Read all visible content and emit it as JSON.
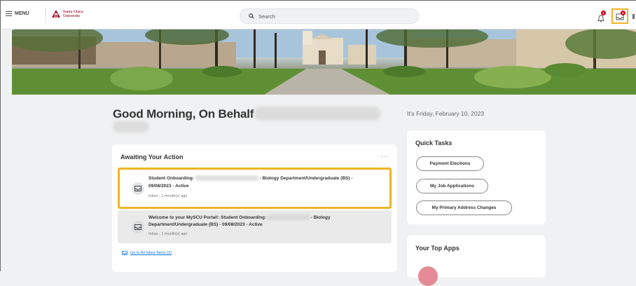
{
  "header": {
    "menu_label": "MENU",
    "logo_line1": "Santa Clara",
    "logo_line2": "University",
    "search_placeholder": "Search",
    "notification_count": "1",
    "inbox_count": "2"
  },
  "greeting": {
    "text": "Good Morning, On Behalf of:",
    "date": "It's Friday, February 10, 2023"
  },
  "awaiting": {
    "title": "Awaiting Your Action",
    "more": "···",
    "items": [
      {
        "line1_prefix": "Student Onboarding: ",
        "line1_suffix": " - Biology Department/Undergraduate (BS) -",
        "line2": "09/08/2023 - Active",
        "meta": "Inbox - 1 month(s) ago"
      },
      {
        "line1_prefix": "Welcome to your MySCU Portal!: Student Onboarding: ",
        "line1_suffix": " - Biology",
        "line2": "Department/Undergraduate (BS) - 09/08/2023 - Active",
        "meta": "Inbox - 1 month(s) ago"
      }
    ],
    "go_to_all": "Go to All Inbox Items (2)"
  },
  "quick_tasks": {
    "title": "Quick Tasks",
    "buttons": [
      "Payment Elections",
      "My Job Applications",
      "My Primary Address Changes"
    ]
  },
  "top_apps": {
    "title": "Your Top Apps"
  },
  "colors": {
    "highlight": "#f0b324",
    "brand": "#9e1b32",
    "link": "#0875e1",
    "badge": "#d0021b"
  }
}
